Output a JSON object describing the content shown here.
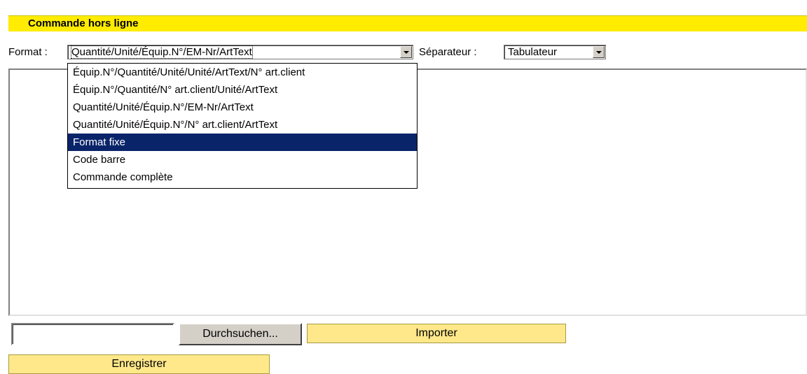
{
  "header": {
    "title": "Commande hors ligne"
  },
  "format": {
    "label": "Format :",
    "selected": "Quantité/Unité/Équip.N°/EM-Nr/ArtText",
    "options": [
      "Équip.N°/Quantité/Unité/Unité/ArtText/N° art.client",
      "Équip.N°/Quantité/N° art.client/Unité/ArtText",
      "Quantité/Unité/Équip.N°/EM-Nr/ArtText",
      "Quantité/Unité/Équip.N°/N° art.client/ArtText",
      "Format fixe",
      "Code barre",
      "Commande complète"
    ],
    "highlighted_option": "Format fixe"
  },
  "separator": {
    "label": "Séparateur :",
    "selected": "Tabulateur"
  },
  "file": {
    "value": "",
    "browse_label": "Durchsuchen..."
  },
  "actions": {
    "import_label": "Importer",
    "save_label": "Enregistrer"
  },
  "colors": {
    "title_bar": "#ffec00",
    "button_yellow": "#ffe88a",
    "highlight": "#0a246a"
  }
}
